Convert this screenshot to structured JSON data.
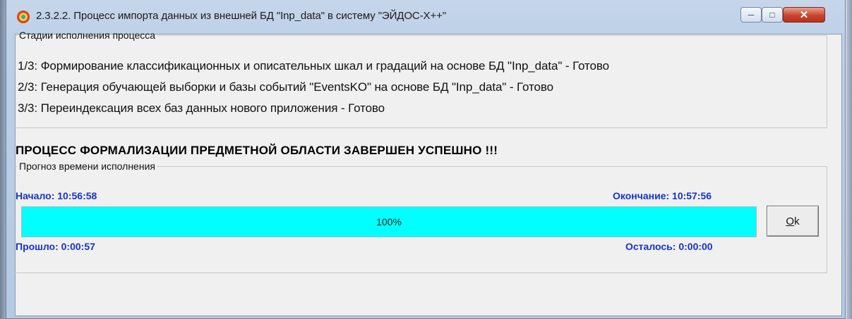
{
  "window": {
    "title": "2.3.2.2. Процесс импорта данных из внешней БД \"Inp_data\" в систему \"ЭЙДОС-X++\"",
    "icon": "eidos-app-icon",
    "controls": {
      "minimize": "minimize-icon",
      "maximize": "maximize-icon",
      "close": "close-icon"
    }
  },
  "stages": {
    "legend": "Стадии исполнения процесса",
    "lines": [
      "1/3: Формирование классификационных и описательных шкал и градаций на основе БД \"Inp_data\" - Готово",
      "2/3: Генерация обучающей выборки и базы событий \"EventsKO\" на основе БД \"Inp_data\" - Готово",
      "3/3: Переиндексация всех баз данных нового приложения - Готово"
    ]
  },
  "status_message": "ПРОЦЕСС ФОРМАЛИЗАЦИИ ПРЕДМЕТНОЙ ОБЛАСТИ ЗАВЕРШЕН УСПЕШНО !!!",
  "forecast": {
    "legend": "Прогноз времени исполнения",
    "start": "Начало: 10:56:58",
    "end": "Окончание: 10:57:56",
    "elapsed": "Прошло: 0:00:57",
    "remaining": "Осталось: 0:00:00",
    "progress_fraction": 1.0,
    "progress_text": "100%",
    "progress_color": "#00ffff",
    "label_color": "#1732c8"
  },
  "ok_button": {
    "label": "Ok",
    "underline_char": "O"
  }
}
